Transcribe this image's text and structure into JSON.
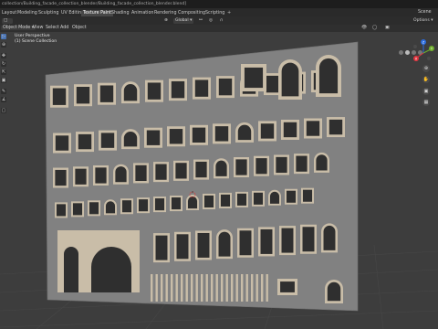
{
  "window": {
    "title": "collection/Building_facade_collection_blender/Building_facade_collection_blender.blend]"
  },
  "workspace_tabs": [
    {
      "label": "Layout",
      "active": false
    },
    {
      "label": "Modeling",
      "active": false
    },
    {
      "label": "Sculpting",
      "active": false
    },
    {
      "label": "UV Editing",
      "active": false
    },
    {
      "label": "Texture Paint",
      "active": true
    },
    {
      "label": "Shading",
      "active": false
    },
    {
      "label": "Animation",
      "active": false
    },
    {
      "label": "Rendering",
      "active": false
    },
    {
      "label": "Compositing",
      "active": false
    },
    {
      "label": "Scripting",
      "active": false
    }
  ],
  "tab_add_label": "+",
  "scene_label": "Scene",
  "toolbar": {
    "transform_orientation": "Global",
    "options_label": "Options"
  },
  "header": {
    "mode": "Object Mode",
    "menus": [
      "View",
      "Select",
      "Add",
      "Object"
    ]
  },
  "viewport": {
    "perspective_label": "User Perspective",
    "collection_label": "(1) Scene Collection"
  },
  "gizmo": {
    "axes": [
      {
        "label": "Z",
        "color": "#2b6ce0"
      },
      {
        "label": "Y",
        "color": "#6fae2c"
      },
      {
        "label": "X",
        "color": "#e0343f"
      }
    ]
  },
  "colors": {
    "wall": "#808080",
    "trim": "#c9bda8",
    "glass": "#2f2f2f",
    "grid_bg": "#3d3d3d",
    "accent": "#4772b3"
  }
}
